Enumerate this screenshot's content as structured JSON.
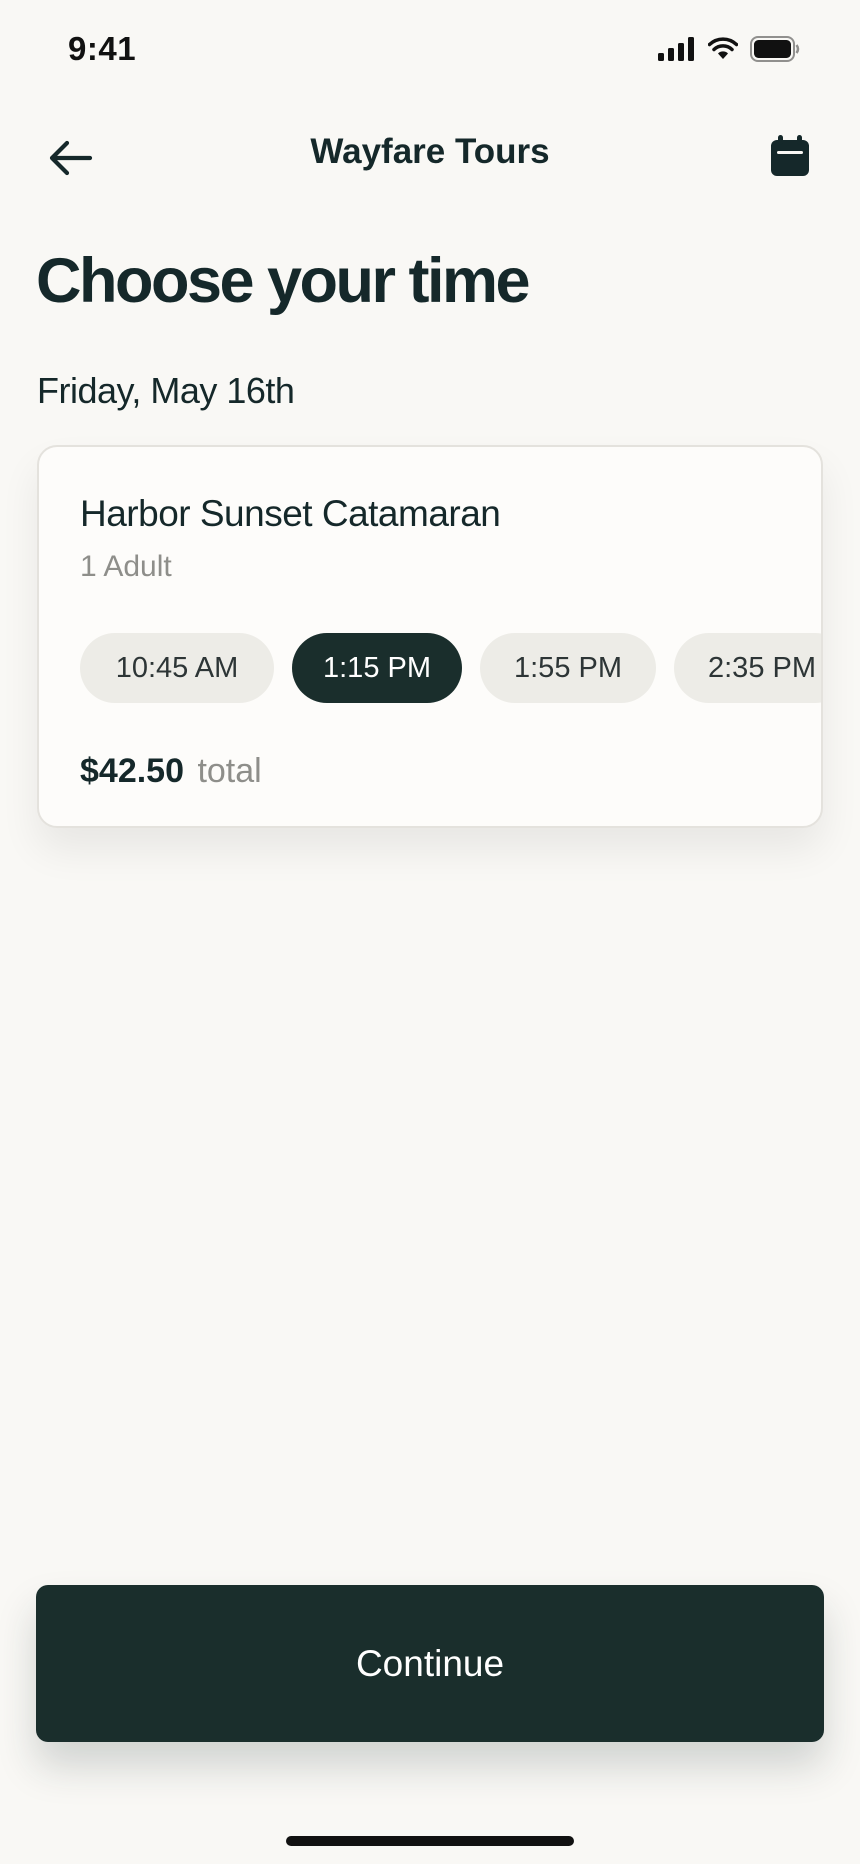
{
  "status_bar": {
    "time": "9:41"
  },
  "nav": {
    "title": "Wayfare Tours",
    "back_icon": "arrow-left-icon",
    "calendar_icon": "calendar-icon"
  },
  "page": {
    "heading": "Choose your time",
    "date": "Friday, May 16th"
  },
  "tour": {
    "name": "Harbor Sunset Catamaran",
    "guests": "1 Adult",
    "time_slots": [
      {
        "label": "10:45 AM",
        "selected": false
      },
      {
        "label": "1:15 PM",
        "selected": true
      },
      {
        "label": "1:55 PM",
        "selected": false
      },
      {
        "label": "2:35 PM",
        "selected": false
      }
    ],
    "total_amount": "$42.50",
    "total_suffix": "total"
  },
  "footer": {
    "continue_label": "Continue"
  },
  "colors": {
    "primary": "#1a2e2c",
    "background": "#f9f8f5",
    "chip": "#edece7",
    "muted_text": "#8e8e8a"
  }
}
